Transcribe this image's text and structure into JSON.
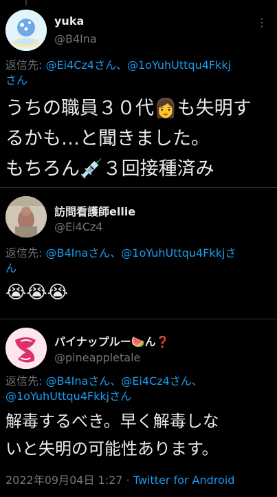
{
  "tweets": [
    {
      "display_name": "yuka",
      "handle": "@B4Ina",
      "reply_prefix": "返信先: ",
      "mentions": [
        "@Ei4Cz4さん、@1oYuhUttqu4Fkkj",
        "さん"
      ],
      "body_lines": [
        "うちの職員３０代👩も失明す",
        "るかも…と聞きました。",
        "もちろん💉３回接種済み"
      ]
    },
    {
      "display_name": "訪問看護師ellie",
      "handle": "@Ei4Cz4",
      "reply_prefix": "返信先: ",
      "mentions": [
        "@B4Inaさん、@1oYuhUttqu4Fkkjさ",
        "ん"
      ],
      "body_lines": [
        "😭😭😭"
      ]
    },
    {
      "display_name": "パイナップルー🍉ん❓",
      "handle": "@pineappletale",
      "reply_prefix": "返信先: ",
      "mentions": [
        "@B4Inaさん、@Ei4Cz4さん、",
        "@1oYuhUttqu4Fkkjさん"
      ],
      "body_lines": [
        "解毒するべき。早く解毒しな",
        "いと失明の可能性あります。"
      ],
      "timestamp": "2022年09月04日 1:27",
      "separator": " · ",
      "source": "Twitter for Android"
    }
  ],
  "icons": {
    "more": "more-options-icon"
  },
  "colors": {
    "background": "#000000",
    "text": "#e7e9ea",
    "muted": "#71767b",
    "link": "#1d9bf0"
  }
}
